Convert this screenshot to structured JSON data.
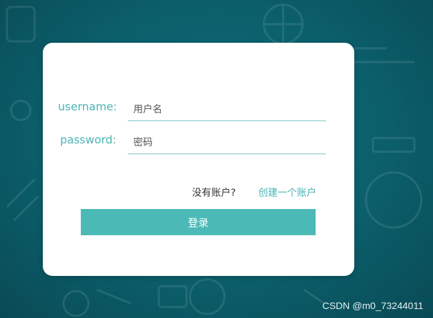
{
  "colors": {
    "background": "#0b5f6b",
    "card": "#ffffff",
    "accent": "#4bb4b6",
    "button": "#4bbab6",
    "input_underline": "#b9dfe1"
  },
  "login_form": {
    "username_label": "username:",
    "username_placeholder": "用户名",
    "password_label": "password:",
    "password_placeholder": "密码",
    "no_account_text": "没有账户?",
    "create_account_link": "创建一个账户",
    "login_button": "登录"
  },
  "watermark": "CSDN @m0_73244011"
}
